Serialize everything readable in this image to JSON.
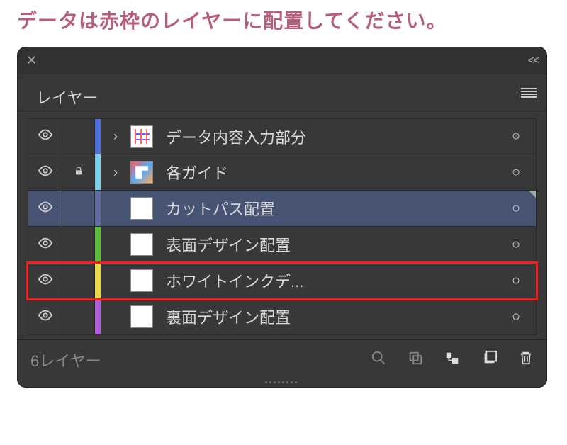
{
  "instruction": "データは赤枠のレイヤーに配置してください。",
  "panel": {
    "tab_label": "レイヤー",
    "footer_count": "6レイヤー"
  },
  "layers": [
    {
      "name": "データ内容入力部分",
      "color": "#4a6fd6",
      "expandable": true,
      "locked": false,
      "selected": false,
      "highlighted": false,
      "thumb": "t1",
      "target": "○"
    },
    {
      "name": "各ガイド",
      "color": "#7ecfe8",
      "expandable": true,
      "locked": true,
      "selected": false,
      "highlighted": false,
      "thumb": "t2",
      "target": "○"
    },
    {
      "name": "カットパス配置",
      "color": "#5f6e9e",
      "expandable": false,
      "locked": false,
      "selected": true,
      "highlighted": false,
      "thumb": "blank",
      "target": "○"
    },
    {
      "name": "表面デザイン配置",
      "color": "#5fbf3f",
      "expandable": false,
      "locked": false,
      "selected": false,
      "highlighted": false,
      "thumb": "blank",
      "target": "○"
    },
    {
      "name": "ホワイトインクデ...",
      "color": "#e8d84a",
      "expandable": false,
      "locked": false,
      "selected": false,
      "highlighted": true,
      "thumb": "blank",
      "target": "○"
    },
    {
      "name": "裏面デザイン配置",
      "color": "#b05fd6",
      "expandable": false,
      "locked": false,
      "selected": false,
      "highlighted": false,
      "thumb": "blank",
      "target": "○"
    }
  ]
}
